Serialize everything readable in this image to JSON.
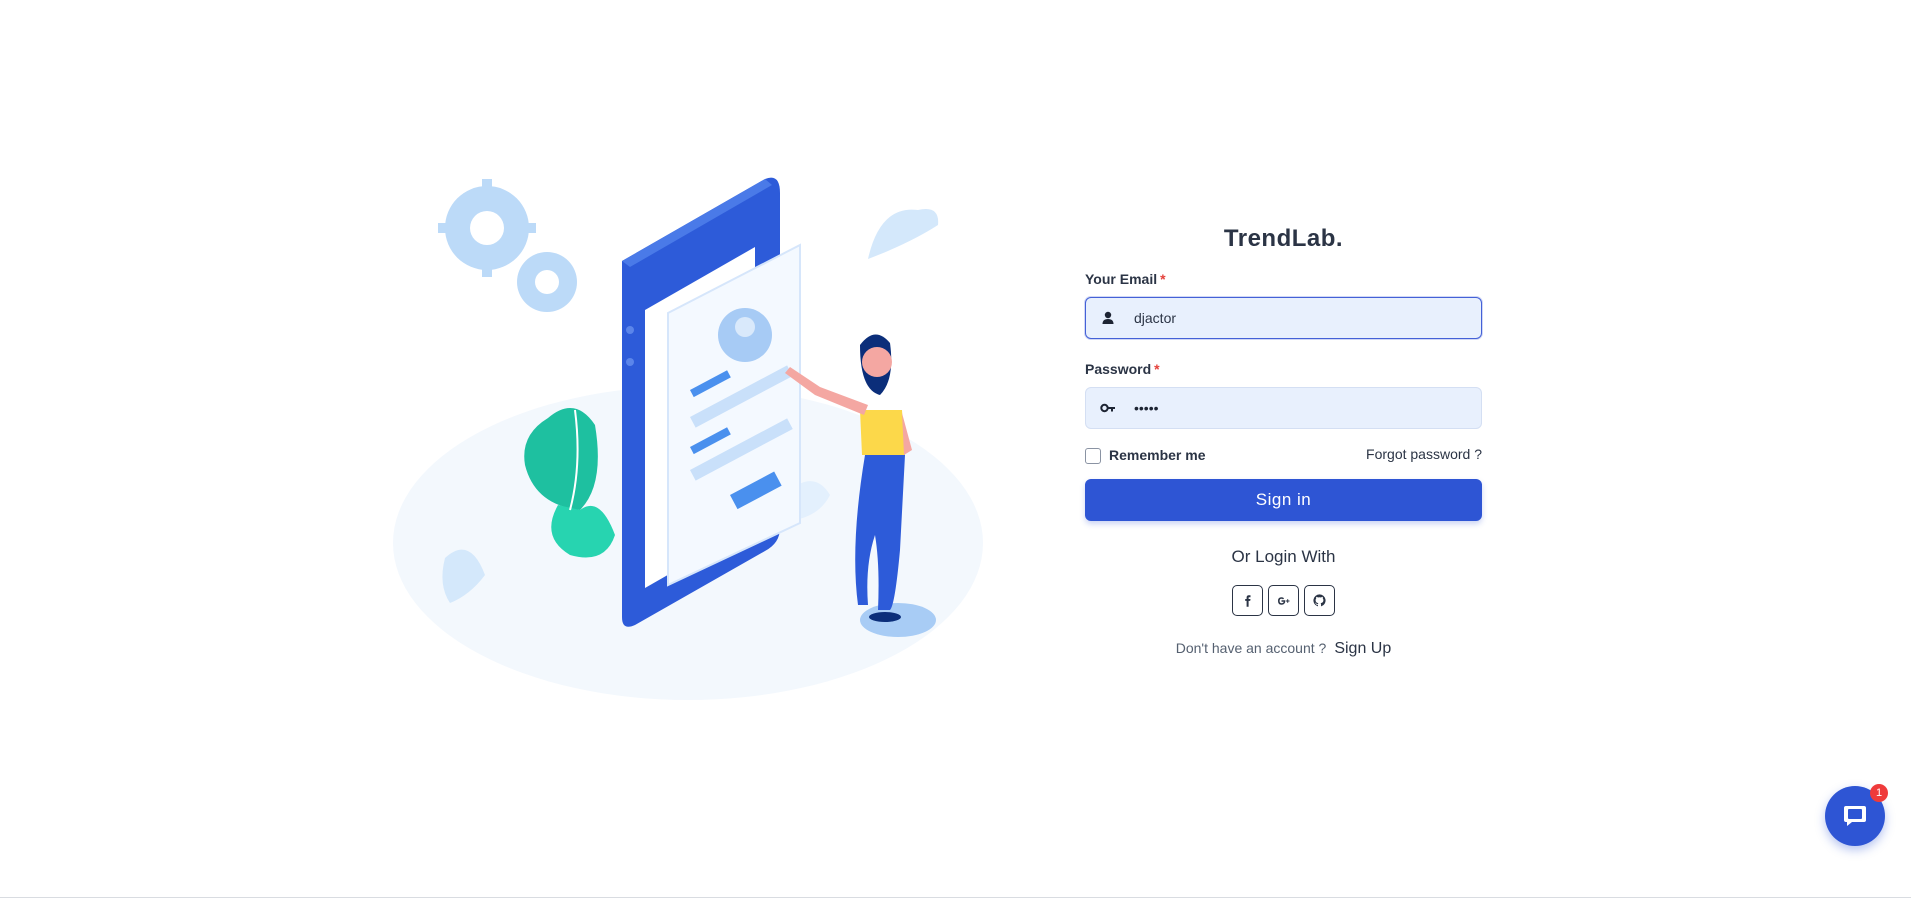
{
  "brand": {
    "name": "TrendLab."
  },
  "form": {
    "email_label": "Your Email",
    "email_required": "*",
    "email_value": "djactor",
    "email_icon": "user-icon",
    "password_label": "Password",
    "password_required": "*",
    "password_masked": "•••••",
    "password_icon": "key-icon",
    "remember_label": "Remember me",
    "remember_checked": false,
    "forgot_label": "Forgot password ?",
    "signin_label": "Sign in",
    "or_login_label": "Or Login With",
    "social": [
      {
        "name": "facebook-icon",
        "glyph": "f"
      },
      {
        "name": "google-plus-icon",
        "glyph": "G+"
      },
      {
        "name": "github-icon",
        "glyph": "gh"
      }
    ],
    "no_account_text": "Don't have an account ?",
    "signup_label": "Sign Up"
  },
  "chat": {
    "icon": "chat-bubble-icon",
    "badge_count": "1"
  },
  "colors": {
    "primary": "#2e55d4",
    "input_bg": "#e8f0fd",
    "text": "#2b3445",
    "required": "#e4413b",
    "badge": "#ef3b3b"
  }
}
